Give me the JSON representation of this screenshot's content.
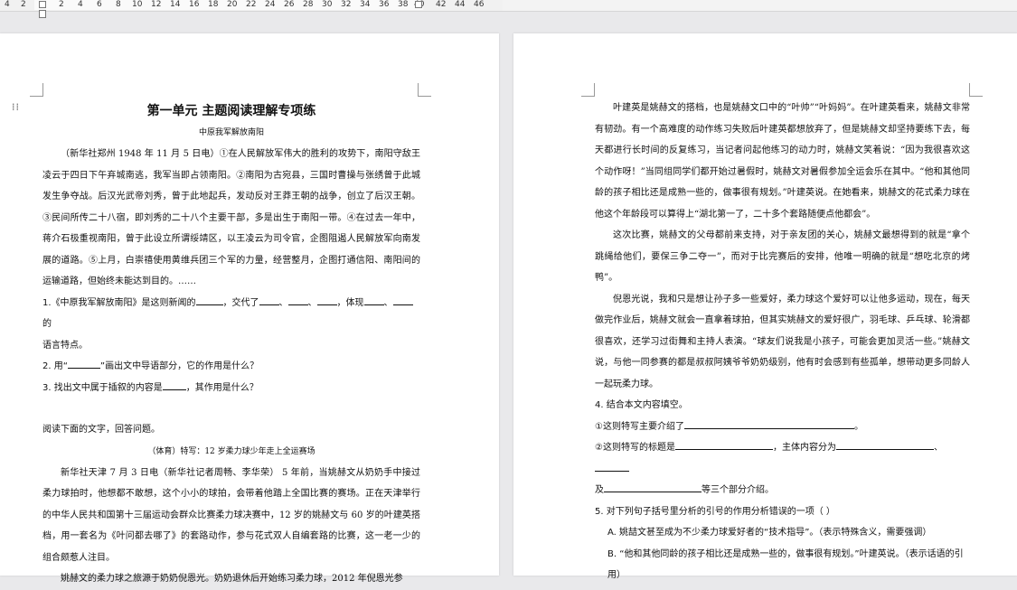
{
  "ruler": {
    "labels": [
      "4",
      "2",
      "2",
      "4",
      "6",
      "8",
      "10",
      "12",
      "14",
      "16",
      "18",
      "20",
      "22",
      "24",
      "26",
      "28",
      "30",
      "32",
      "34",
      "36",
      "38",
      "40",
      "42",
      "44",
      "46"
    ]
  },
  "left_page": {
    "title": "第一单元 主题阅读理解专项练",
    "subtitle": "中原我军解放南阳",
    "p1": "（新华社郑州 1948 年 11 月 5 日电）①在人民解放军伟大的胜利的攻势下，南阳守敌王凌云于四日下午弃城南逃，我军当即占领南阳。②南阳为古宛县，三国时曹操与张绣曾于此城发生争夺战。后汉光武帝刘秀，曾于此地起兵，发动反对王莽王朝的战争，创立了后汉王朝。③民间所传二十八宿，即刘秀的二十八个主要干部，多是出生于南阳一带。④在过去一年中，蒋介石极重视南阳，曾于此设立所谓绥靖区，以王凌云为司令官，企图阻遏人民解放军向南发展的道路。⑤上月，白崇禧使用黄维兵团三个军的力量，经营整月，企图打通信阳、南阳间的运输道路，但始终未能达到目的。……",
    "q1_a": "1.《中原我军解放南阳》是这则新闻的",
    "q1_b": "，交代了",
    "q1_sep1": "、",
    "q1_sep2": "、",
    "q1_c": "，体现",
    "q1_sep3": "、",
    "q1_d": "的",
    "q1_e": "语言特点。",
    "q2_a": "2. 用“",
    "q2_b": "”画出文中导语部分，它的作用是什么？",
    "q3_a": "3. 找出文中属于插叙的内容是",
    "q3_b": "，其作用是什么？",
    "instruction": "阅读下面的文字，回答问题。",
    "article_title": "（体育）特写：12 岁柔力球少年走上全运赛场",
    "p2": "新华社天津 7 月 3 日电（新华社记者周畅、李华荣） 5 年前，当姚赫文从奶奶手中接过柔力球拍时，他想都不敢想，这个小小的球拍，会带着他踏上全国比赛的赛场。正在天津举行的中华人民共和国第十三届运动会群众比赛柔力球决赛中，12 岁的姚赫文与 60 岁的叶建英搭档，用一套名为《叶问都去哪了》的套路动作，参与花式双人自编套路的比赛，这一老一少的组合颇惹人注目。",
    "p3": "姚赫文的柔力球之旅源于奶奶倪恩光。奶奶退休后开始练习柔力球，2012 年倪恩光参"
  },
  "right_page": {
    "p1": "叶建英是姚赫文的搭档，也是姚赫文口中的“叶帅”“叶妈妈”。在叶建英看来，姚赫文非常有韧劲。有一个高难度的动作练习失败后叶建英都想放弃了，但是姚赫文却坚持要练下去，每天都进行长时间的反复练习，当记者问起他练习的动力时，姚赫文笑着说：“因为我很喜欢这个动作呀！”当同组同学们都开始过暑假时，姚赫文对暑假参加全运会乐在其中。“他和其他同龄的孩子相比还是成熟一些的，做事很有规划。”叶建英说。在她看来，姚赫文的花式柔力球在他这个年龄段可以算得上“湖北第一了，二十多个套路随便点他都会”。",
    "p2": "这次比赛，姚赫文的父母都前来支持，对于亲友团的关心，姚赫文最想得到的就是“拿个跳绳给他们，要保三争二夺一”，而对于比完赛后的安排，他唯一明确的就是“想吃北京的烤鸭”。",
    "p3": "倪恩光说，我和只是想让孙子多一些爱好，柔力球这个爱好可以让他多运动，现在，每天做完作业后，姚赫文就会一直拿着球拍，但其实姚赫文的爱好很广，羽毛球、乒乓球、轮滑都很喜欢，还学习过街舞和主持人表演。“球友们说我是小孩子，可能会更加灵活一些。”姚赫文说，与他一同参赛的都是叔叔阿姨爷爷奶奶级别，他有时会感到有些孤单，想带动更多同龄人一起玩柔力球。",
    "q4": "4. 结合本文内容填空。",
    "q4_1_a": "①这则特写主要介绍了",
    "q4_1_b": "。",
    "q4_2_a": "②这则特写的标题是",
    "q4_2_b": "，主体内容分为",
    "q4_2_c": "、",
    "q4_3_a": "及",
    "q4_3_b": "等三个部分介绍。",
    "q5": "5. 对下列句子括号里分析的引号的作用分析错误的一项（ ）",
    "choice_a": "A. 姚喆文甚至成为不少柔力球爱好者的“技术指导”。（表示特殊含义，需要强调）",
    "choice_b": "B. “他和其他同龄的孩子相比还是成熟一些的，做事很有规划。”叶建英说。（表示话语的引用）"
  }
}
